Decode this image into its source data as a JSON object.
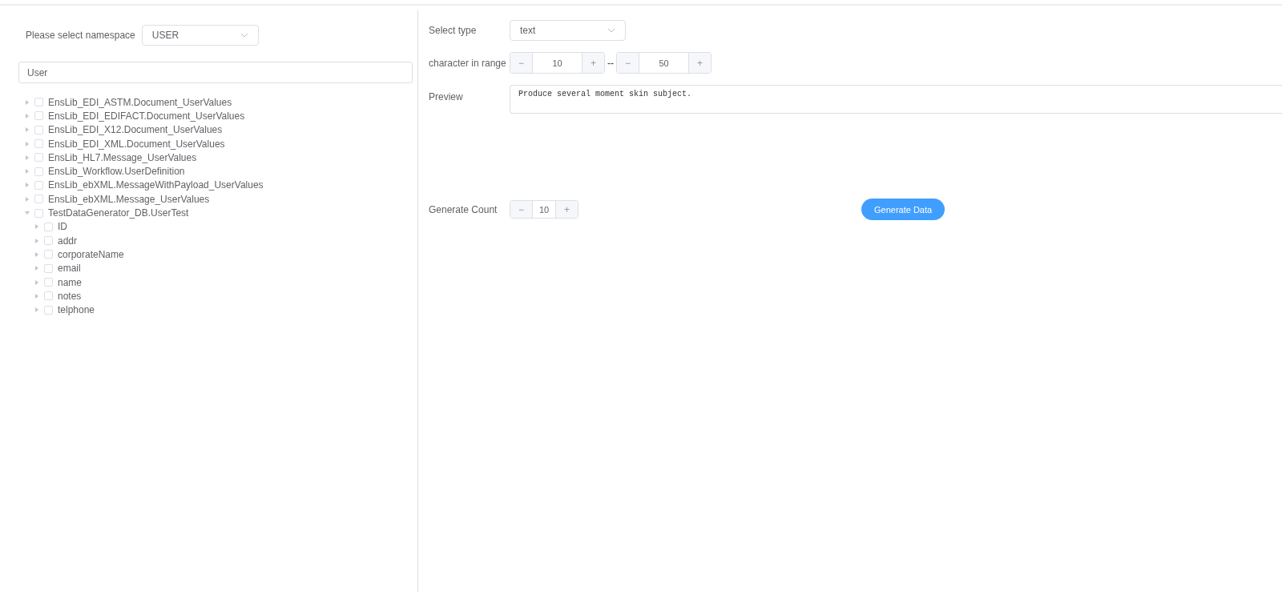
{
  "namespace": {
    "label": "Please select namespace",
    "value": "USER"
  },
  "search": {
    "value": "User"
  },
  "tree": [
    {
      "label": "EnsLib_EDI_ASTM.Document_UserValues",
      "expanded": false,
      "checked": false
    },
    {
      "label": "EnsLib_EDI_EDIFACT.Document_UserValues",
      "expanded": false,
      "checked": false
    },
    {
      "label": "EnsLib_EDI_X12.Document_UserValues",
      "expanded": false,
      "checked": false
    },
    {
      "label": "EnsLib_EDI_XML.Document_UserValues",
      "expanded": false,
      "checked": false
    },
    {
      "label": "EnsLib_HL7.Message_UserValues",
      "expanded": false,
      "checked": false
    },
    {
      "label": "EnsLib_Workflow.UserDefinition",
      "expanded": false,
      "checked": false
    },
    {
      "label": "EnsLib_ebXML.MessageWithPayload_UserValues",
      "expanded": false,
      "checked": false
    },
    {
      "label": "EnsLib_ebXML.Message_UserValues",
      "expanded": false,
      "checked": false
    },
    {
      "label": "TestDataGenerator_DB.UserTest",
      "expanded": true,
      "checked": false,
      "children": [
        {
          "label": "ID",
          "expanded": false,
          "checked": false
        },
        {
          "label": "addr",
          "expanded": false,
          "checked": false
        },
        {
          "label": "corporateName",
          "expanded": false,
          "checked": false
        },
        {
          "label": "email",
          "expanded": false,
          "checked": false
        },
        {
          "label": "name",
          "expanded": false,
          "checked": false
        },
        {
          "label": "notes",
          "expanded": false,
          "checked": false
        },
        {
          "label": "telphone",
          "expanded": false,
          "checked": false
        }
      ]
    }
  ],
  "type": {
    "label": "Select type",
    "value": "text"
  },
  "range": {
    "label": "character in range",
    "min": "10",
    "separator": "--",
    "max": "50",
    "minus": "−",
    "plus": "+"
  },
  "preview": {
    "label": "Preview",
    "value": "Produce several moment skin subject."
  },
  "count": {
    "label": "Generate Count",
    "value": "10",
    "minus": "−",
    "plus": "+"
  },
  "generate_button": "Generate Data"
}
